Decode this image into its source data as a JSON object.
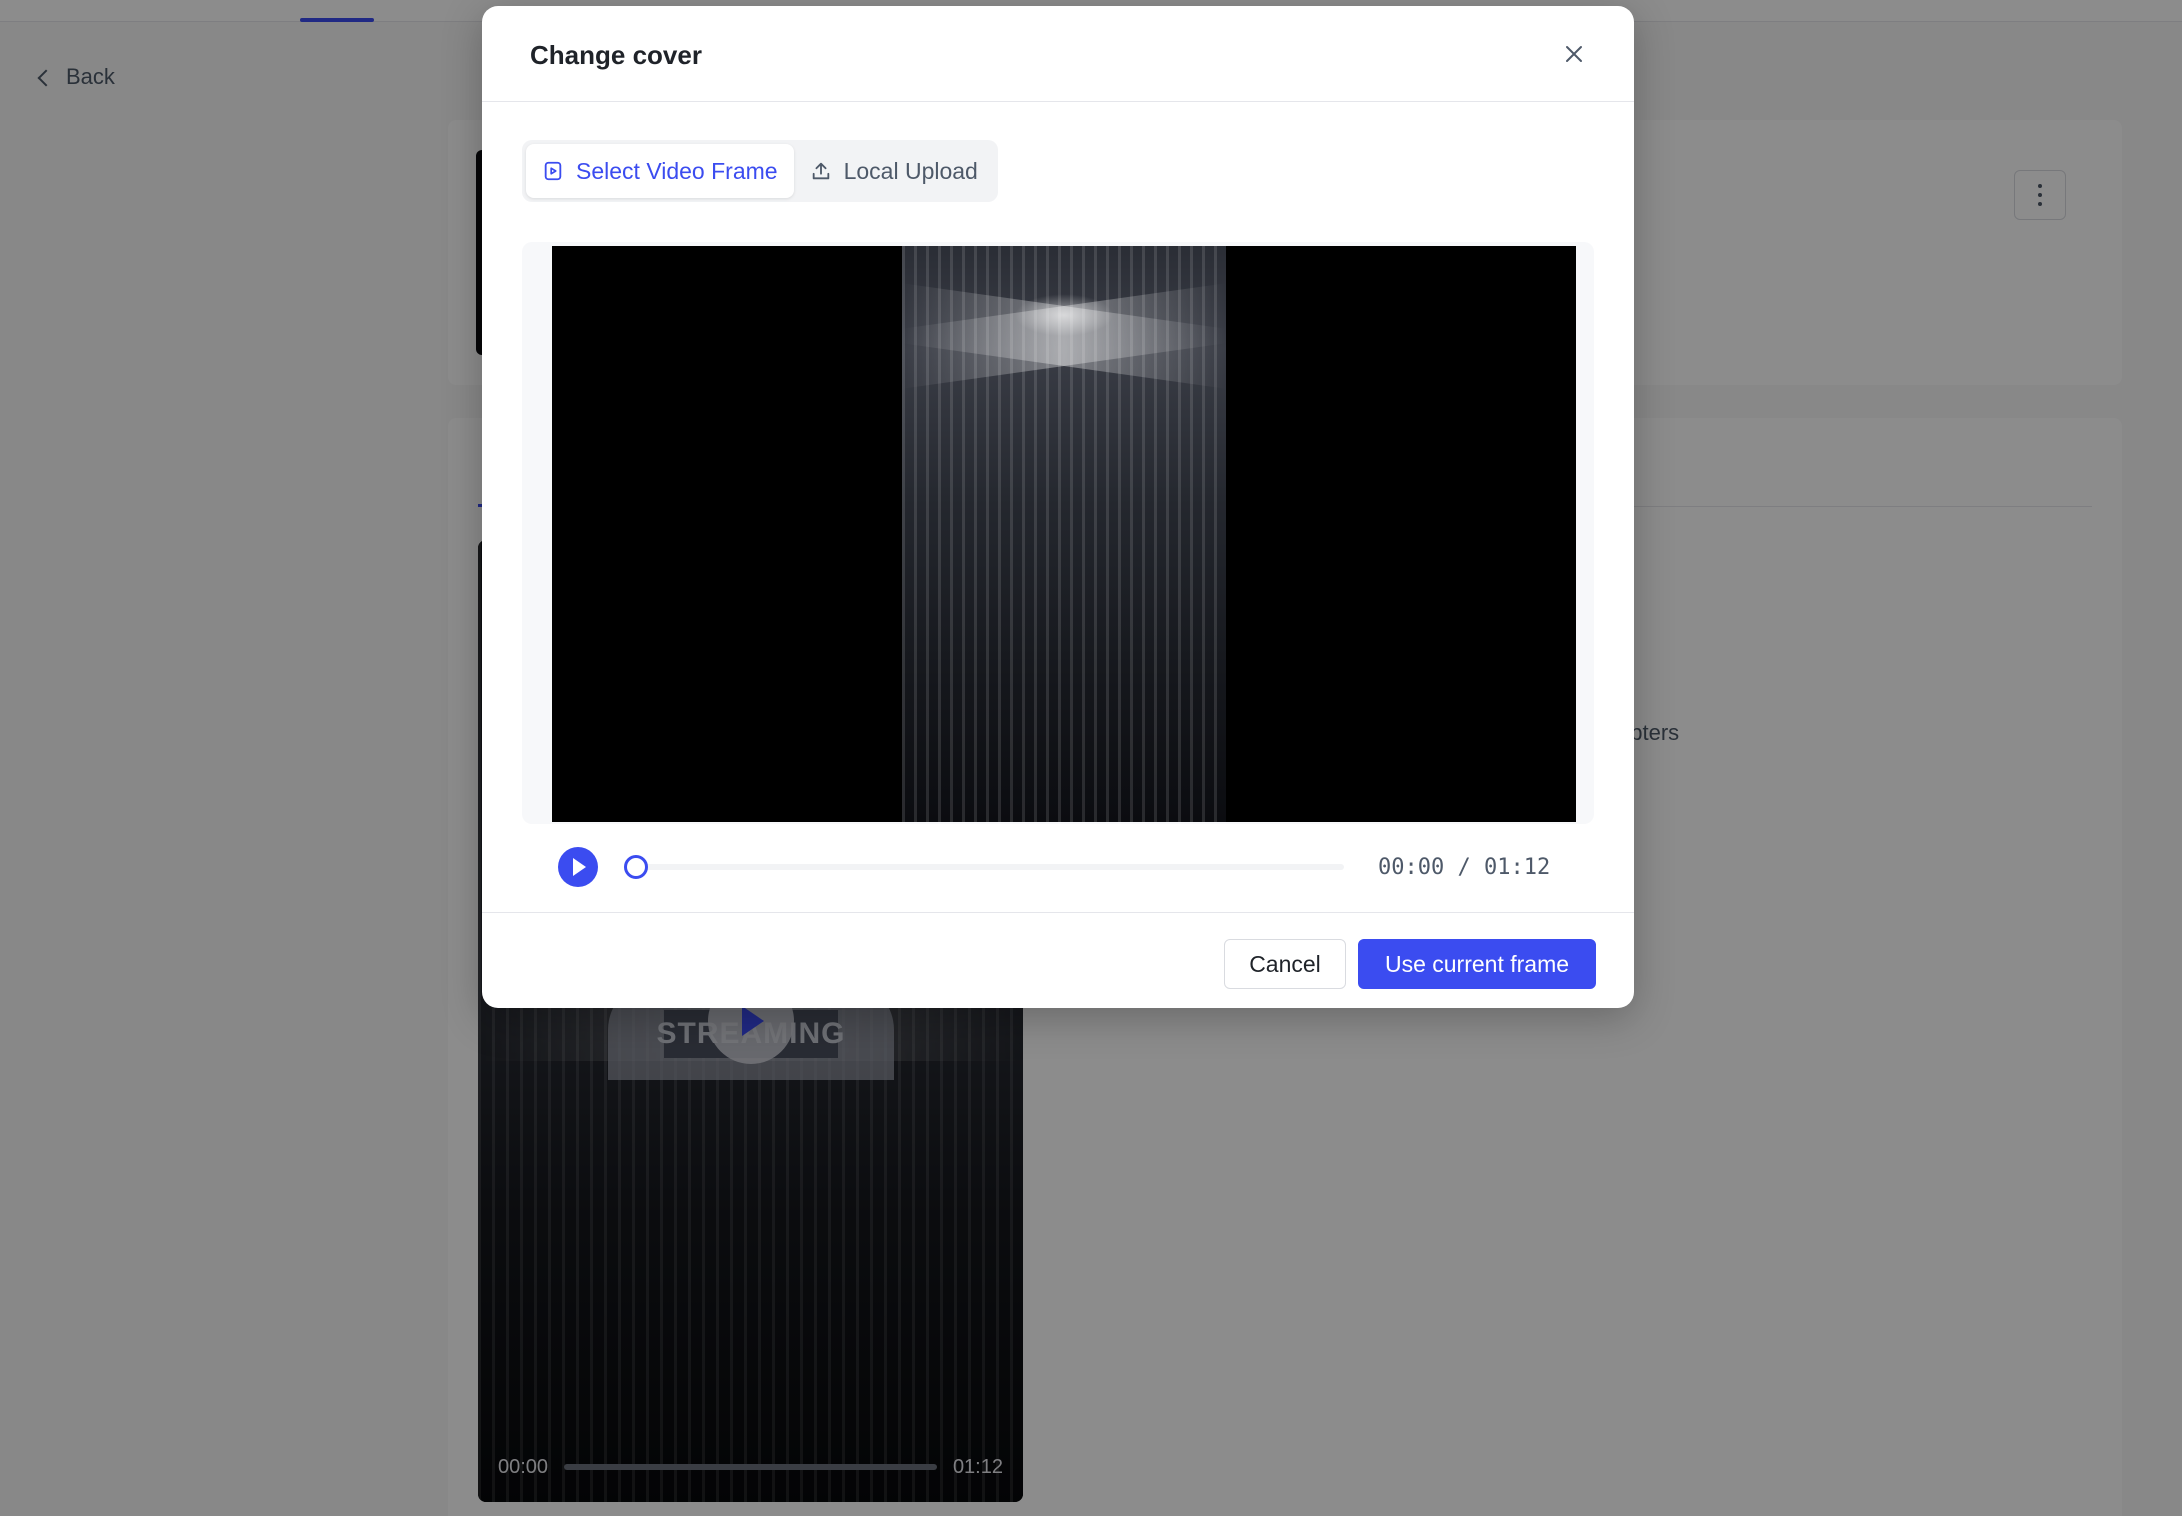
{
  "page": {
    "back_label": "Back",
    "chapters_partial": "apters",
    "player": {
      "overlay_text": "STREAMING",
      "current_time": "00:00",
      "duration": "01:12"
    }
  },
  "modal": {
    "title": "Change cover",
    "tabs": [
      {
        "label": "Select Video Frame",
        "icon": "frame-select-icon",
        "active": true
      },
      {
        "label": "Local Upload",
        "icon": "upload-icon",
        "active": false
      }
    ],
    "video": {
      "current_time": "00:00",
      "duration": "01:12",
      "time_separator": " / ",
      "progress": 0
    },
    "footer": {
      "cancel_label": "Cancel",
      "confirm_label": "Use current frame"
    }
  },
  "colors": {
    "accent": "#3b4cf0",
    "mask": "rgba(0,0,0,0.45)"
  }
}
